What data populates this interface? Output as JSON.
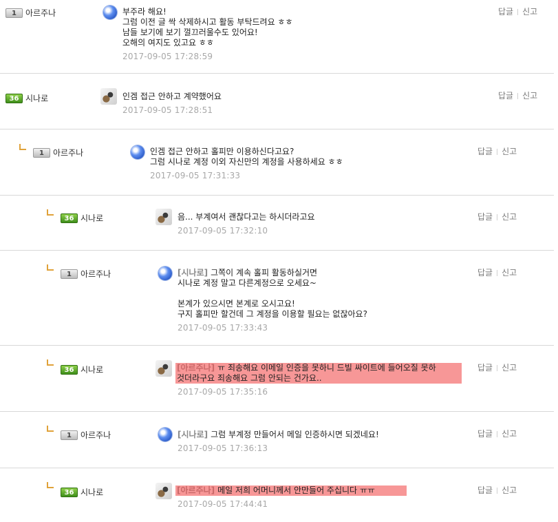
{
  "actions": {
    "reply": "답글",
    "report": "신고"
  },
  "comments": [
    {
      "level": "1",
      "author": "아르주나",
      "avatar": "blue-orb",
      "lines": [
        "부주라 해요!",
        "그럼 이전 글 싹 삭제하시고 활동 부탁드려요 ㅎㅎ",
        "남들 보기에 보기 껄끄러울수도 있어요!",
        "오해의 여지도 있고요 ㅎㅎ"
      ],
      "date": "2017-09-05 17:28:59"
    },
    {
      "level": "36",
      "author": "시나로",
      "avatar": "cat-character",
      "lines": [
        "인겜 접근 안하고 계약했어요"
      ],
      "date": "2017-09-05 17:28:51"
    },
    {
      "level": "1",
      "author": "아르주나",
      "avatar": "blue-orb",
      "lines": [
        "인겜 접근 안하고 홀피만 이용하신다고요?",
        "그럼 시나로 계정 이외 자신만의 계정을 사용하세요 ㅎㅎ"
      ],
      "date": "2017-09-05 17:31:33"
    },
    {
      "level": "36",
      "author": "시나로",
      "avatar": "cat-character",
      "lines": [
        "음... 부계여서 괜찮다고는 하시더라고요"
      ],
      "date": "2017-09-05 17:32:10"
    },
    {
      "level": "1",
      "author": "아르주나",
      "avatar": "blue-orb",
      "mention": "[시나로]",
      "lines": [
        "그쪽이 계속 홀피 활동하실거면",
        "시나로 계정 말고 다른계정으로 오세요~",
        "",
        "본계가 있으시면 본계로 오시고요!",
        "구지 홀피만 할건데 그 계정을 이용할 필요는 없잖아요?"
      ],
      "date": "2017-09-05 17:33:43"
    },
    {
      "level": "36",
      "author": "시나로",
      "avatar": "cat-character",
      "mention": "[아르주나]",
      "lines": [
        "ㅠ 죄송해요 이메일 인증을 못하니 드빌 싸이트에 들어오질 못하",
        "것더라구요 죄송해요 그럼 안되는 건가요.."
      ],
      "date": "2017-09-05 17:35:16"
    },
    {
      "level": "1",
      "author": "아르주나",
      "avatar": "blue-orb",
      "mention": "[시나로]",
      "lines": [
        "그럼 부계정 만들어서 메일 인증하시면 되겠네요!"
      ],
      "date": "2017-09-05 17:36:13"
    },
    {
      "level": "36",
      "author": "시나로",
      "avatar": "cat-character",
      "mention": "[아르주나]",
      "lines": [
        "메일 저희 어머니께서 안만들어 주십니다 ㅠㅠ"
      ],
      "date": "2017-09-05 17:44:41"
    }
  ]
}
